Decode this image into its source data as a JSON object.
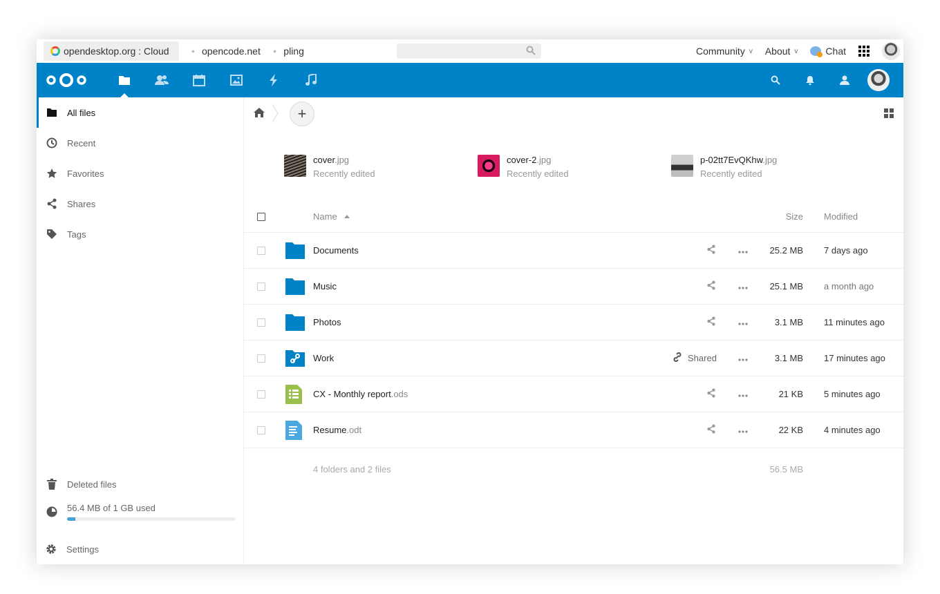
{
  "sitebar": {
    "active_site": "opendesktop.org : Cloud",
    "sites": [
      "opencode.net",
      "pling"
    ],
    "right": {
      "community": "Community",
      "about": "About",
      "chat": "Chat"
    }
  },
  "header": {
    "apps": [
      "files",
      "contacts",
      "calendar",
      "photos",
      "activity",
      "music"
    ],
    "active_app": "files",
    "colors": {
      "brand": "#0082c9"
    }
  },
  "sidebar": {
    "items": [
      {
        "label": "All files",
        "icon": "folder-icon"
      },
      {
        "label": "Recent",
        "icon": "clock-icon"
      },
      {
        "label": "Favorites",
        "icon": "star-icon"
      },
      {
        "label": "Shares",
        "icon": "share-icon"
      },
      {
        "label": "Tags",
        "icon": "tag-icon"
      }
    ],
    "deleted": "Deleted files",
    "quota": {
      "text": "56.4 MB of 1 GB used",
      "fraction": 0.056
    },
    "settings": "Settings"
  },
  "recents": [
    {
      "base": "cover",
      "ext": ".jpg",
      "status": "Recently edited"
    },
    {
      "base": "cover-2",
      "ext": ".jpg",
      "status": "Recently edited"
    },
    {
      "base": "p-02tt7EvQKhw",
      "ext": ".jpg",
      "status": "Recently edited"
    }
  ],
  "table": {
    "headers": {
      "name": "Name",
      "size": "Size",
      "modified": "Modified"
    },
    "rows": [
      {
        "base": "Documents",
        "ext": "",
        "size": "25.2 MB",
        "modified": "7 days ago",
        "type": "folder",
        "shared_label": ""
      },
      {
        "base": "Music",
        "ext": "",
        "size": "25.1 MB",
        "modified": "a month ago",
        "type": "folder",
        "shared_label": ""
      },
      {
        "base": "Photos",
        "ext": "",
        "size": "3.1 MB",
        "modified": "11 minutes ago",
        "type": "folder",
        "shared_label": ""
      },
      {
        "base": "Work",
        "ext": "",
        "size": "3.1 MB",
        "modified": "17 minutes ago",
        "type": "folder-shared",
        "shared_label": "Shared"
      },
      {
        "base": "CX - Monthly report",
        "ext": ".ods",
        "size": "21 KB",
        "modified": "5 minutes ago",
        "type": "spreadsheet",
        "shared_label": ""
      },
      {
        "base": "Resume",
        "ext": ".odt",
        "size": "22 KB",
        "modified": "4 minutes ago",
        "type": "document",
        "shared_label": ""
      }
    ],
    "summary": {
      "text": "4 folders and 2 files",
      "size": "56.5 MB"
    }
  }
}
